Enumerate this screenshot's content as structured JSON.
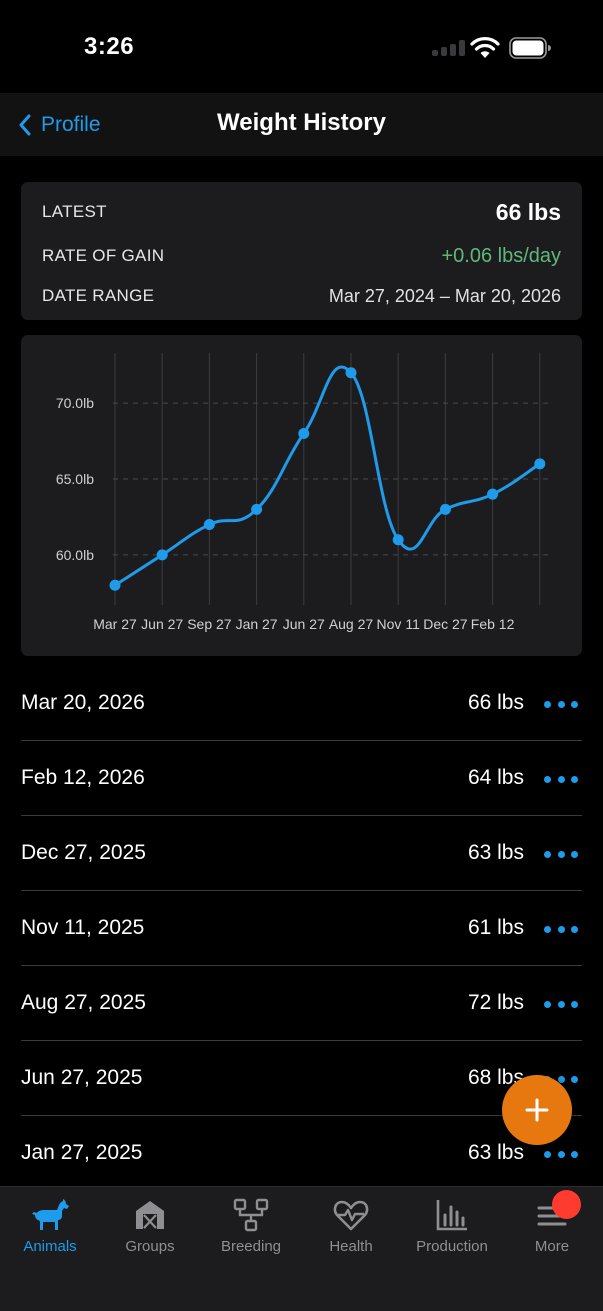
{
  "status_bar": {
    "time": "3:26"
  },
  "nav": {
    "back_label": "Profile",
    "title": "Weight History"
  },
  "summary": {
    "latest_label": "LATEST",
    "latest_value": "66 lbs",
    "rate_label": "RATE OF GAIN",
    "rate_value": "+0.06 lbs/day",
    "range_label": "DATE RANGE",
    "range_value": "Mar 27, 2024 – Mar 20, 2026",
    "rate_color": "#5fb87a"
  },
  "chart_data": {
    "type": "line",
    "categories": [
      "Mar 27",
      "Jun 27",
      "Sep 27",
      "Jan 27",
      "Jun 27",
      "Aug 27",
      "Nov 11",
      "Dec 27",
      "Feb 12"
    ],
    "x_dates": [
      "2024-03-27",
      "2024-06-27",
      "2024-09-27",
      "2025-01-27",
      "2025-06-27",
      "2025-08-27",
      "2025-11-11",
      "2025-12-27",
      "2026-02-12",
      "2026-03-20"
    ],
    "values": [
      58,
      60,
      62,
      63,
      68,
      72,
      61,
      63,
      64,
      66
    ],
    "y_ticks": [
      60,
      65,
      70
    ],
    "y_tick_labels": [
      "60.0lb",
      "65.0lb",
      "70.0lb"
    ],
    "ylim": [
      56.7,
      73.3
    ],
    "grid": true,
    "line_color": "#1e9bea"
  },
  "entries": [
    {
      "date": "Mar 20, 2026",
      "weight": "66 lbs"
    },
    {
      "date": "Feb 12, 2026",
      "weight": "64 lbs"
    },
    {
      "date": "Dec 27, 2025",
      "weight": "63 lbs"
    },
    {
      "date": "Nov 11, 2025",
      "weight": "61 lbs"
    },
    {
      "date": "Aug 27, 2025",
      "weight": "72 lbs"
    },
    {
      "date": "Jun 27, 2025",
      "weight": "68 lbs"
    },
    {
      "date": "Jan 27, 2025",
      "weight": "63 lbs"
    }
  ],
  "fab": {
    "icon": "plus-icon",
    "color": "#e6780f"
  },
  "tabs": [
    {
      "label": "Animals",
      "icon": "goat-icon",
      "active": true
    },
    {
      "label": "Groups",
      "icon": "barn-icon",
      "active": false
    },
    {
      "label": "Breeding",
      "icon": "pedigree-icon",
      "active": false
    },
    {
      "label": "Health",
      "icon": "heart-pulse-icon",
      "active": false
    },
    {
      "label": "Production",
      "icon": "bar-chart-icon",
      "active": false
    },
    {
      "label": "More",
      "icon": "menu-icon",
      "active": false
    }
  ],
  "colors": {
    "accent": "#1e9bea",
    "background": "#000000",
    "card": "#1c1c1e",
    "badge": "#ff3b30"
  }
}
